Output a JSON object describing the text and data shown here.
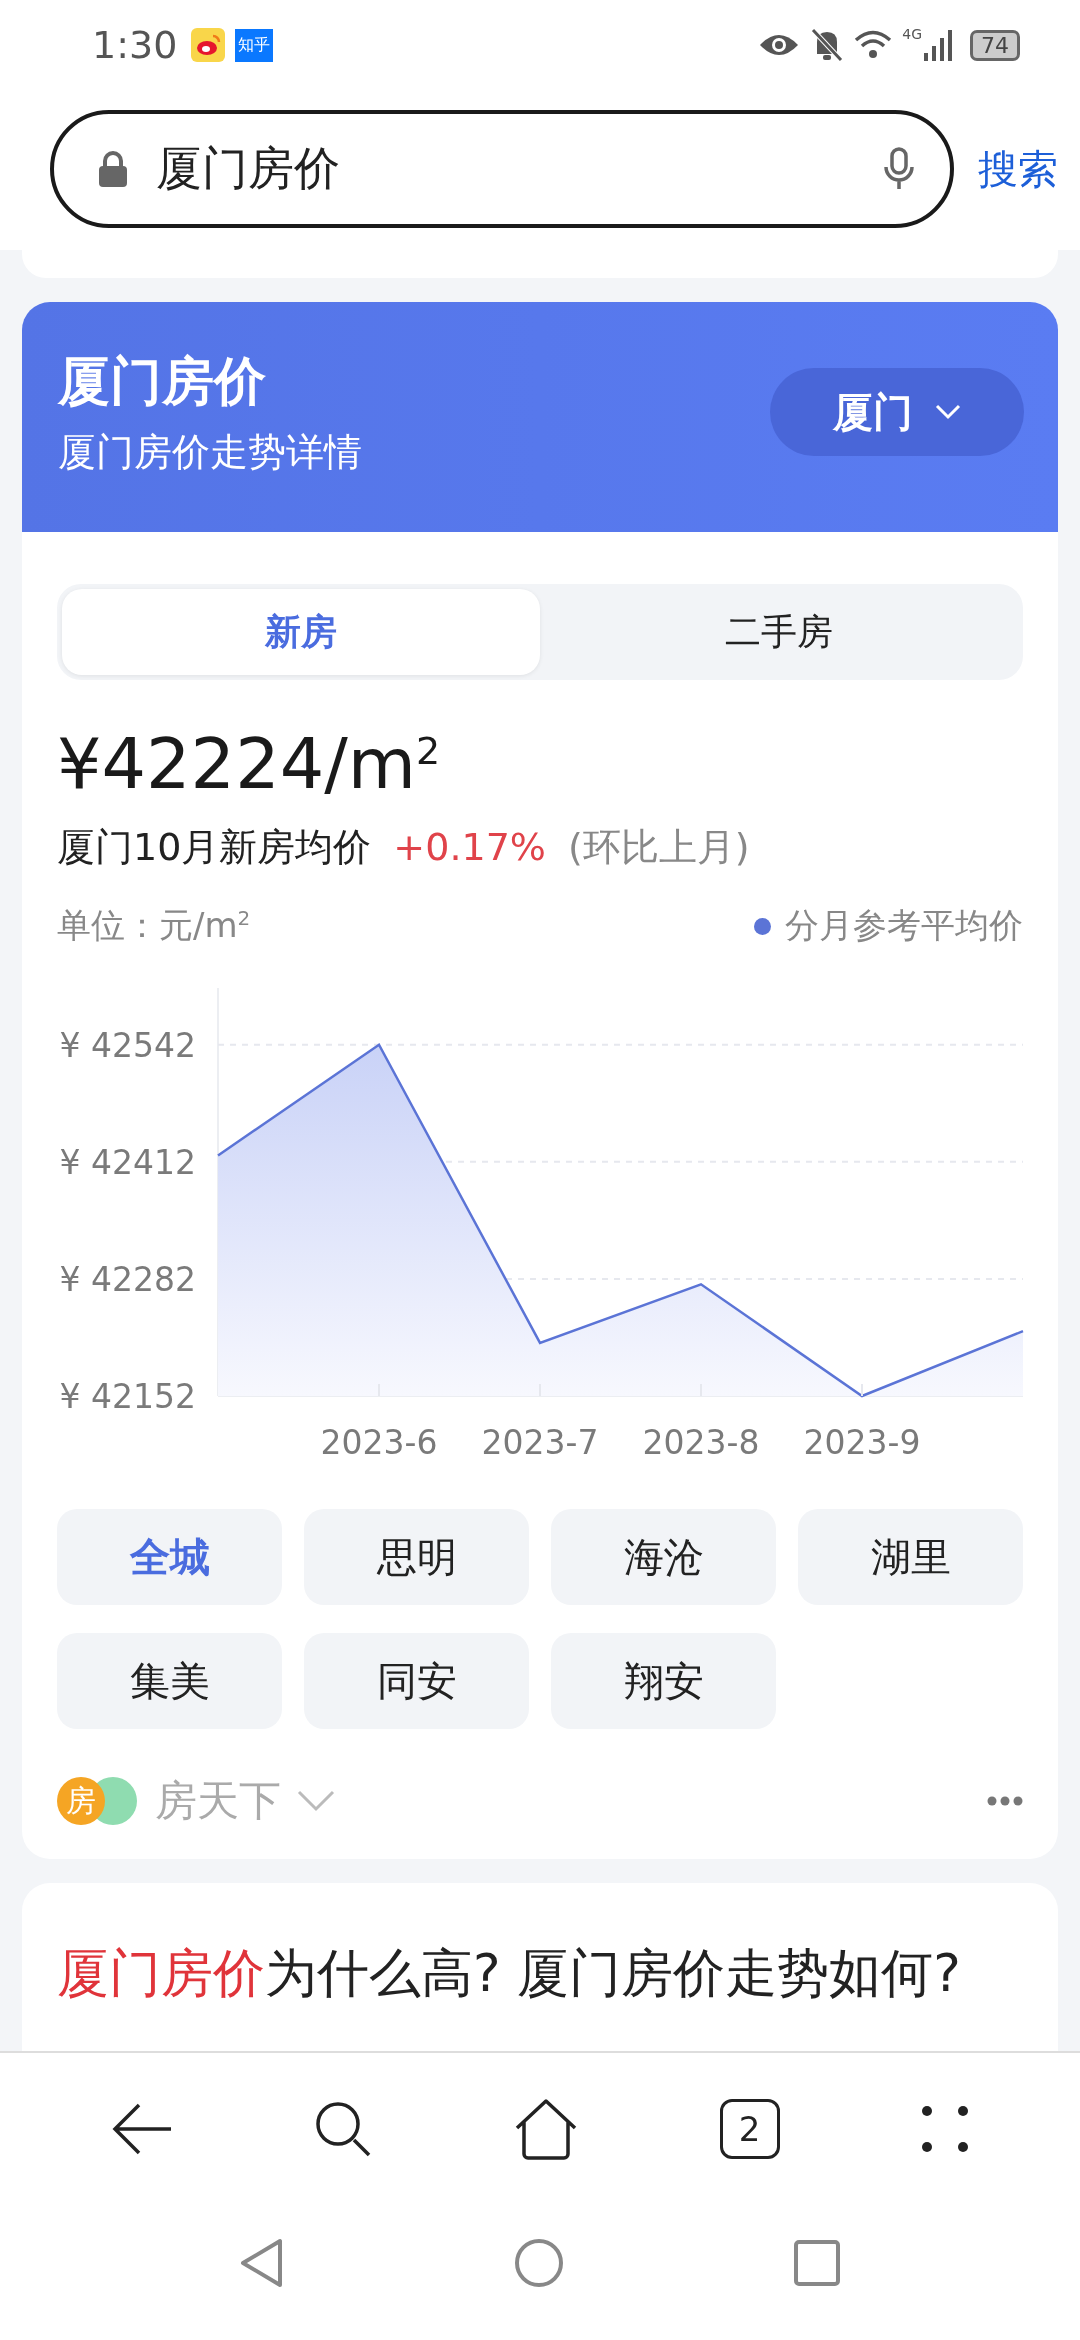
{
  "status_bar": {
    "time": "1:30",
    "zhihu_label": "知乎",
    "battery": "74",
    "network": "4G"
  },
  "search": {
    "value": "厦门房价",
    "button": "搜索"
  },
  "header": {
    "title": "厦门房价",
    "subtitle": "厦门房价走势详情",
    "city": "厦门"
  },
  "tabs": [
    {
      "label": "新房",
      "selected": true
    },
    {
      "label": "二手房",
      "selected": false
    }
  ],
  "price": {
    "value": "¥42224/m$^{2}$",
    "caption": "厦门10月新房均价",
    "change": "+0.17%",
    "note": "(环比上月)"
  },
  "unit": "单位：元/m$^{2}$",
  "chart_data": {
    "type": "area",
    "categories": [
      null,
      "2023-6",
      "2023-7",
      "2023-8",
      "2023-9",
      null
    ],
    "series": [
      {
        "name": "分月参考平均价",
        "color": "#5b74d6",
        "values": [
          42419,
          42542,
          42211,
          42276,
          42152,
          42224
        ]
      }
    ],
    "yticks": [
      {
        "value": 42542,
        "label": "¥ 42542"
      },
      {
        "value": 42412,
        "label": "¥ 42412"
      },
      {
        "value": 42282,
        "label": "¥ 42282"
      },
      {
        "value": 42152,
        "label": "¥ 42152"
      }
    ],
    "ylim": [
      42152,
      42605
    ],
    "grid": true
  },
  "districts": [
    {
      "label": "全城",
      "selected": true
    },
    {
      "label": "思明",
      "selected": false
    },
    {
      "label": "海沧",
      "selected": false
    },
    {
      "label": "湖里",
      "selected": false
    },
    {
      "label": "集美",
      "selected": false
    },
    {
      "label": "同安",
      "selected": false
    },
    {
      "label": "翔安",
      "selected": false
    }
  ],
  "source": {
    "icon_label": "房",
    "name": "房天下"
  },
  "article": {
    "highlight": "厦门房价",
    "rest": "为什么高? 厦门房价走势如何?"
  },
  "browser_bar": {
    "tab_count": "2"
  }
}
